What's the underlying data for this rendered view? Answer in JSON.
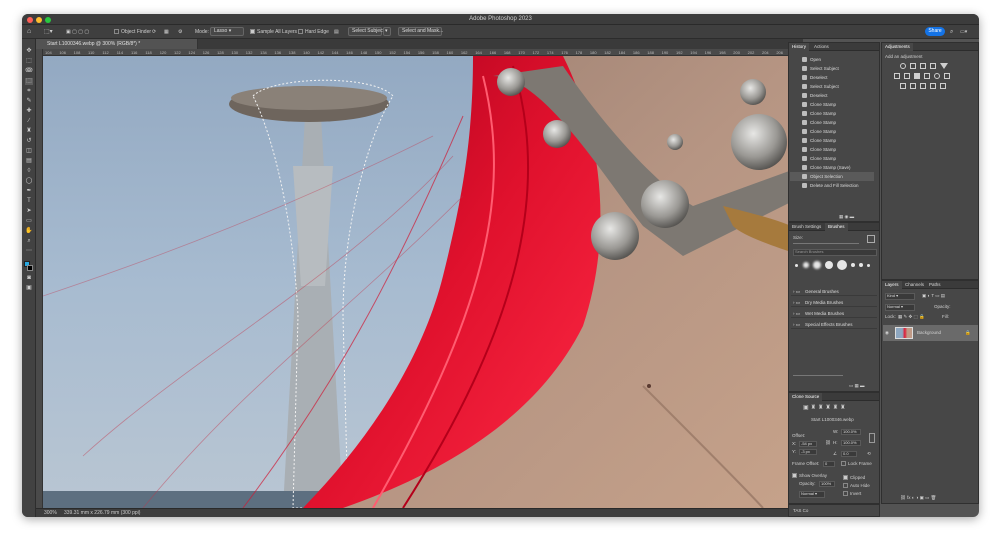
{
  "window": {
    "title": "Adobe Photoshop 2023"
  },
  "options_bar": {
    "object_finder": "Object Finder",
    "mode_label": "Mode:",
    "mode_value": "Lasso",
    "sample_all_layers": "Sample All Layers",
    "hard_edge": "Hard Edge",
    "select_subject": "Select Subject",
    "select_and_mask": "Select and Mask...",
    "share": "Share"
  },
  "document": {
    "tab_title": "Start L1000346.webp @ 300% (RGB/8*) *"
  },
  "ruler_ticks": [
    "104",
    "106",
    "108",
    "110",
    "112",
    "114",
    "116",
    "118",
    "120",
    "122",
    "124",
    "126",
    "128",
    "130",
    "132",
    "134",
    "136",
    "138",
    "140",
    "142",
    "144",
    "146",
    "148",
    "150",
    "152",
    "154",
    "156",
    "158",
    "160",
    "162",
    "164",
    "166",
    "168",
    "170",
    "172",
    "174",
    "176",
    "178",
    "180",
    "182",
    "184",
    "186",
    "188",
    "190",
    "192",
    "194",
    "196",
    "198",
    "200",
    "202",
    "204",
    "206",
    "208"
  ],
  "status": {
    "zoom": "300%",
    "dims": "339.31 mm x 226.79 mm (300 ppi)"
  },
  "history": {
    "tabs": [
      "History",
      "Actions"
    ],
    "items": [
      "Open",
      "Select Subject",
      "Deselect",
      "Select Subject",
      "Deselect",
      "Clone Stamp",
      "Clone Stamp",
      "Clone Stamp",
      "Clone Stamp",
      "Clone Stamp",
      "Clone Stamp",
      "Clone Stamp",
      "Clone Stamp (Save)",
      "Object Selection",
      "Delete and Fill Selection"
    ],
    "selected_index": 13
  },
  "brushes": {
    "tabs": [
      "Brush Settings",
      "Brushes"
    ],
    "size_label": "Size:",
    "search_placeholder": "Search Brushes",
    "folders": [
      "General Brushes",
      "Dry Media Brushes",
      "Wet Media Brushes",
      "Special Effects Brushes"
    ]
  },
  "clone_source": {
    "title": "Clone Source",
    "source_name": "Start L1000346.webp",
    "offset_label": "Offset:",
    "x_label": "X:",
    "x_value": "-54 px",
    "y_label": "Y:",
    "y_value": "-3 px",
    "w_label": "W:",
    "w_value": "100.0%",
    "h_label": "H:",
    "h_value": "100.0%",
    "angle_value": "0.0",
    "frame_offset_label": "Frame Offset:",
    "frame_offset_value": "0",
    "lock_frame": "Lock Frame",
    "show_overlay": "Show Overlay",
    "opacity_label": "Opacity:",
    "opacity_value": "100%",
    "blend_mode": "Normal",
    "clipped": "Clipped",
    "auto_hide": "Auto Hide",
    "invert": "Invert"
  },
  "adjustments": {
    "title": "Adjustments",
    "subtitle": "Add an adjustment"
  },
  "layers": {
    "tabs": [
      "Layers",
      "Channels",
      "Paths"
    ],
    "kind": "Kind",
    "blend": "Normal",
    "opacity_label": "Opacity:",
    "lock_label": "Lock:",
    "fill_label": "Fill:",
    "layer_name": "Background"
  },
  "footer_panel": "TAS Co"
}
